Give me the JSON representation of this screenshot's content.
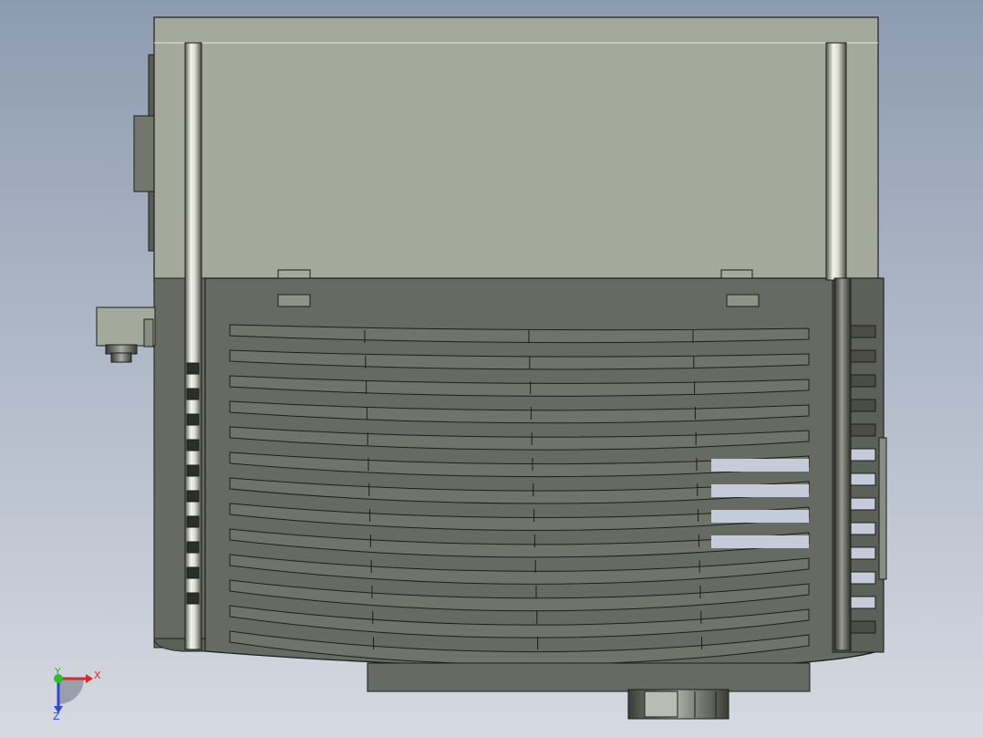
{
  "viewport": {
    "background_top": "#8d9bb1",
    "background_bottom": "#d5d9e1"
  },
  "model": {
    "name": "",
    "upper_housing_color": "#a4a99b",
    "lower_housing_color": "#676a62",
    "edge_color": "#1c1e1a",
    "rail_highlight_color": "#f2f2ea",
    "vent_slot_count": 13,
    "side_slot_count": 13,
    "left_rail_slot_count": 10
  },
  "triad": {
    "x_label": "X",
    "y_label": "Y",
    "z_label": "Z",
    "x_color": "#d8282a",
    "y_color": "#2fbd2f",
    "z_color": "#2f46d6"
  }
}
